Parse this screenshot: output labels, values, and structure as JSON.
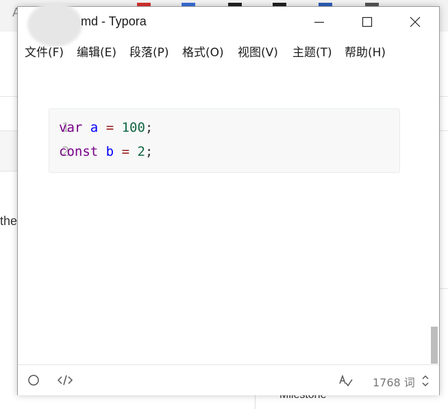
{
  "background": {
    "left_letter": "A",
    "left_text": "the",
    "bottom_text": "Milestone"
  },
  "window": {
    "title": "md - Typora",
    "controls": {
      "minimize_icon": "minimize-icon",
      "maximize_icon": "maximize-icon",
      "close_icon": "close-icon"
    }
  },
  "menu": {
    "items": [
      {
        "label": "文件(F)"
      },
      {
        "label": "编辑(E)"
      },
      {
        "label": "段落(P)"
      },
      {
        "label": "格式(O)"
      },
      {
        "label": "视图(V)"
      },
      {
        "label": "主题(T)"
      },
      {
        "label": "帮助(H)"
      }
    ]
  },
  "editor": {
    "code": {
      "line_numbers": [
        "1",
        "2"
      ],
      "lines": [
        [
          {
            "text": "var",
            "kind": "keyword"
          },
          {
            "text": " ",
            "kind": "space"
          },
          {
            "text": "a",
            "kind": "def"
          },
          {
            "text": " ",
            "kind": "space"
          },
          {
            "text": "=",
            "kind": "operator"
          },
          {
            "text": " ",
            "kind": "space"
          },
          {
            "text": "100",
            "kind": "number"
          },
          {
            "text": ";",
            "kind": "punctuation"
          }
        ],
        [
          {
            "text": "const",
            "kind": "keyword"
          },
          {
            "text": " ",
            "kind": "space"
          },
          {
            "text": "b",
            "kind": "def"
          },
          {
            "text": " ",
            "kind": "space"
          },
          {
            "text": "=",
            "kind": "operator"
          },
          {
            "text": " ",
            "kind": "space"
          },
          {
            "text": "2",
            "kind": "number"
          },
          {
            "text": ";",
            "kind": "punctuation"
          }
        ]
      ]
    }
  },
  "statusbar": {
    "outline_icon": "circle-icon",
    "source_icon": "code-icon",
    "spellcheck_icon": "spellcheck-icon",
    "word_count": "1768 词",
    "word_count_toggle_icon": "chevron-updown-icon"
  },
  "colors": {
    "keyword": "#770088",
    "def": "#0000ff",
    "operator": "#981a1a",
    "number": "#116644",
    "punctuation": "#333333",
    "code_background": "#f8f8f8"
  }
}
